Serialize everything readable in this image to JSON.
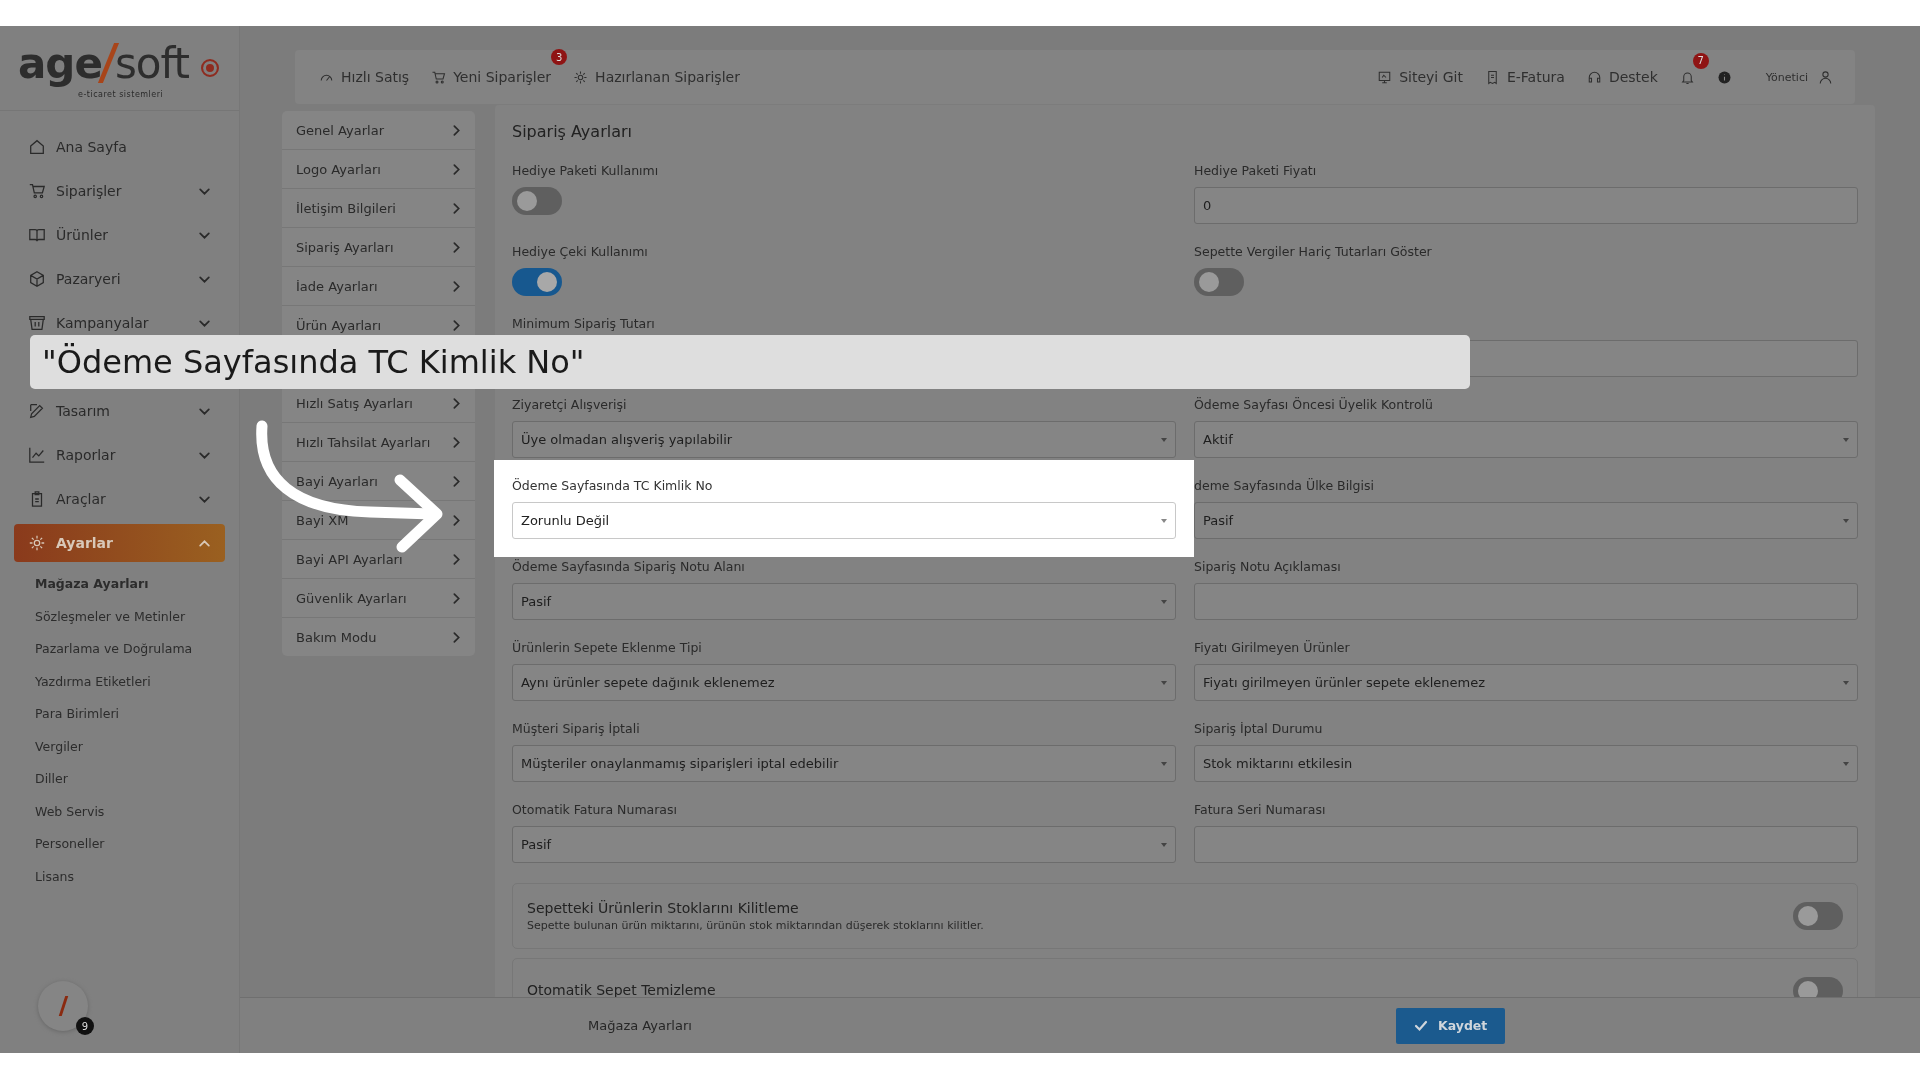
{
  "logo": {
    "left": "age",
    "right": "soft",
    "tagline": "e-ticaret sistemleri"
  },
  "sidebar": {
    "items": [
      {
        "label": "Ana Sayfa",
        "expandable": false,
        "expanded": false,
        "selected": false
      },
      {
        "label": "Siparişler",
        "expandable": true,
        "expanded": false,
        "selected": false
      },
      {
        "label": "Ürünler",
        "expandable": true,
        "expanded": false,
        "selected": false
      },
      {
        "label": "Pazaryeri",
        "expandable": true,
        "expanded": false,
        "selected": false
      },
      {
        "label": "Kampanyalar",
        "expandable": true,
        "expanded": false,
        "selected": false
      },
      {
        "label": "Tasarım",
        "expandable": true,
        "expanded": false,
        "selected": false
      },
      {
        "label": "Raporlar",
        "expandable": true,
        "expanded": false,
        "selected": false
      },
      {
        "label": "Araçlar",
        "expandable": true,
        "expanded": false,
        "selected": false
      },
      {
        "label": "Ayarlar",
        "expandable": true,
        "expanded": true,
        "selected": true,
        "children": [
          {
            "label": "Mağaza Ayarları",
            "selected": true
          },
          {
            "label": "Sözleşmeler ve Metinler",
            "selected": false
          },
          {
            "label": "Pazarlama ve Doğrulama",
            "selected": false
          },
          {
            "label": "Yazdırma Etiketleri",
            "selected": false
          },
          {
            "label": "Para Birimleri",
            "selected": false
          },
          {
            "label": "Vergiler",
            "selected": false
          },
          {
            "label": "Diller",
            "selected": false
          },
          {
            "label": "Web Servis",
            "selected": false
          },
          {
            "label": "Personeller",
            "selected": false
          },
          {
            "label": "Lisans",
            "selected": false
          }
        ]
      }
    ],
    "avatar_badge": "9"
  },
  "header": {
    "left": [
      {
        "label": "Hızlı Satış"
      },
      {
        "label": "Yeni Siparişler",
        "badge": "3"
      },
      {
        "label": "Hazırlanan Siparişler"
      }
    ],
    "right": [
      {
        "label": "Siteyi Git"
      },
      {
        "label": "E-Fatura"
      },
      {
        "label": "Destek"
      }
    ],
    "notifications_badge": "7",
    "user": "Yönetici"
  },
  "submenu": [
    {
      "label": "Genel Ayarlar"
    },
    {
      "label": "Logo Ayarları"
    },
    {
      "label": "İletişim Bilgileri"
    },
    {
      "label": "Sipariş Ayarları"
    },
    {
      "label": "İade Ayarları"
    },
    {
      "label": "Ürün Ayarları"
    },
    {
      "label": "Hızlı Satış Ayarları"
    },
    {
      "label": "Hızlı Tahsilat Ayarları"
    },
    {
      "label": "Bayi Ayarları"
    },
    {
      "label": "Bayi XM"
    },
    {
      "label": "Bayi API Ayarları"
    },
    {
      "label": "Güvenlik Ayarları"
    },
    {
      "label": "Bakım Modu"
    }
  ],
  "page_title": "Sipariş Ayarları",
  "rows": [
    [
      {
        "kind": "toggle",
        "label": "Hediye Paketi Kullanımı",
        "on": false
      },
      {
        "kind": "input",
        "label": "Hediye Paketi Fiyatı",
        "value": "0"
      }
    ],
    [
      {
        "kind": "toggle",
        "label": "Hediye Çeki Kullanımı",
        "on": true
      },
      {
        "kind": "toggle",
        "label": "Sepette Vergiler Hariç Tutarları Göster",
        "on": false
      }
    ],
    [
      {
        "kind": "label",
        "label": "Minimum Sipariş Tutarı"
      },
      {
        "kind": "input"
      }
    ],
    [
      {
        "kind": "select",
        "label": "Ziyaretçi Alışverişi",
        "value": "Üye olmadan alışveriş yapılabilir"
      },
      {
        "kind": "select",
        "label": "Ödeme Sayfası Öncesi Üyelik Kontrolü",
        "value": "Aktif"
      }
    ],
    [
      {
        "kind": "select",
        "label": "Ödeme Sayfasında TC Kimlik No",
        "value": "Zorunlu Değil",
        "highlighted": true
      },
      {
        "kind": "select",
        "label": "deme Sayfasında Ülke Bilgisi",
        "value": "Pasif"
      }
    ],
    [
      {
        "kind": "select",
        "label": "Ödeme Sayfasında Sipariş Notu Alanı",
        "value": "Pasif"
      },
      {
        "kind": "input",
        "label": "Sipariş Notu Açıklaması"
      }
    ],
    [
      {
        "kind": "select",
        "label": "Ürünlerin Sepete Eklenme Tipi",
        "value": "Aynı ürünler sepete dağınık eklenemez"
      },
      {
        "kind": "select",
        "label": "Fiyatı Girilmeyen Ürünler",
        "value": "Fiyatı girilmeyen ürünler sepete eklenemez"
      }
    ],
    [
      {
        "kind": "select",
        "label": "Müşteri Sipariş İptali",
        "value": "Müşteriler onaylanmamış siparişleri iptal edebilir"
      },
      {
        "kind": "select",
        "label": "Sipariş İptal Durumu",
        "value": "Stok miktarını etkilesin"
      }
    ],
    [
      {
        "kind": "select",
        "label": "Otomatik Fatura Numarası",
        "value": "Pasif"
      },
      {
        "kind": "input",
        "label": "Fatura Seri Numarası"
      }
    ]
  ],
  "cards": [
    {
      "title": "Sepetteki Ürünlerin Stoklarını Kilitleme",
      "description": "Sepette bulunan ürün miktarını, ürünün stok miktarından düşerek stoklarını kilitler.",
      "on": false
    },
    {
      "title": "Otomatik Sepet Temizleme",
      "on": false
    }
  ],
  "footer": {
    "title": "Mağaza Ayarları",
    "button": "Kaydet"
  },
  "caption": "\"Ödeme Sayfasında TC Kimlik No\""
}
